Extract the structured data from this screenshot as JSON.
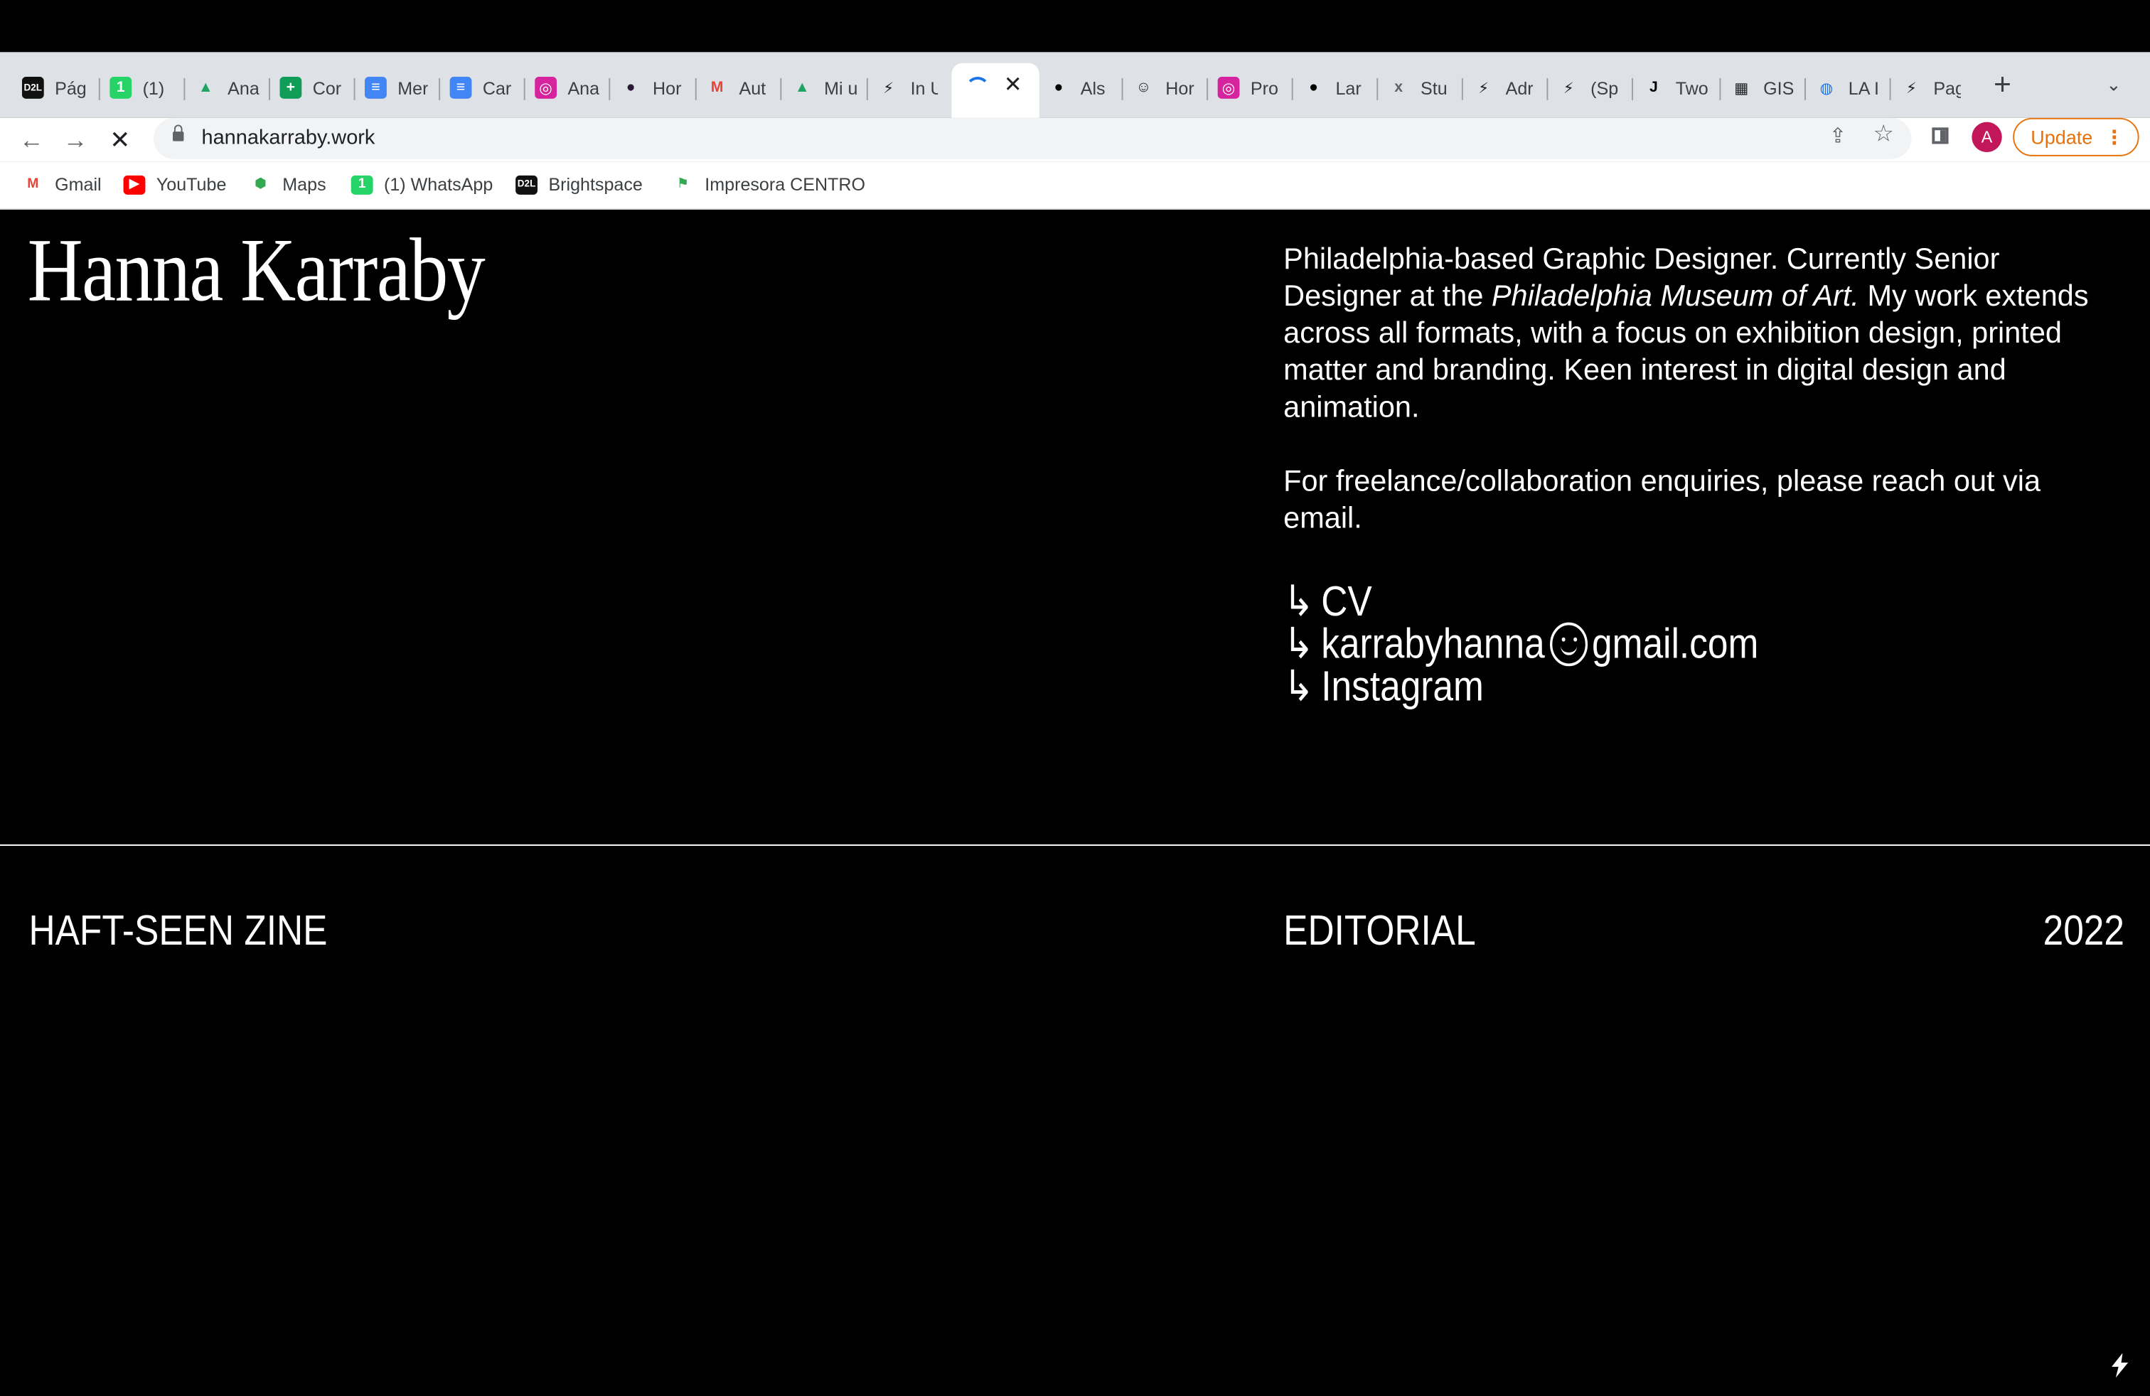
{
  "browser": {
    "tabs": [
      {
        "title": "Pág",
        "icon": "d2l-icon",
        "icon_glyph": "D2L",
        "icon_bg": "#111111",
        "icon_fg": "#ffffff"
      },
      {
        "title": "(1)",
        "icon": "whatsapp-icon",
        "icon_glyph": "1",
        "icon_bg": "#25d366",
        "icon_fg": "#ffffff"
      },
      {
        "title": "Ana",
        "icon": "google-drive-icon",
        "icon_glyph": "▲",
        "icon_bg": "transparent",
        "icon_fg": "#1fa463"
      },
      {
        "title": "Cor",
        "icon": "google-sheets-icon",
        "icon_glyph": "+",
        "icon_bg": "#0f9d58",
        "icon_fg": "#ffffff"
      },
      {
        "title": "Mer",
        "icon": "google-docs-icon",
        "icon_glyph": "≡",
        "icon_bg": "#4285f4",
        "icon_fg": "#ffffff"
      },
      {
        "title": "Car",
        "icon": "google-docs-icon",
        "icon_glyph": "≡",
        "icon_bg": "#4285f4",
        "icon_fg": "#ffffff"
      },
      {
        "title": "Ana",
        "icon": "instagram-icon",
        "icon_glyph": "◎",
        "icon_bg": "#d6249f",
        "icon_fg": "#ffffff"
      },
      {
        "title": "Hor",
        "icon": "dark-circle-icon",
        "icon_glyph": "●",
        "icon_bg": "transparent",
        "icon_fg": "#2b1836"
      },
      {
        "title": "Aut",
        "icon": "gmail-icon",
        "icon_glyph": "M",
        "icon_bg": "transparent",
        "icon_fg": "#ea4335"
      },
      {
        "title": "Mi u",
        "icon": "google-drive-icon",
        "icon_glyph": "▲",
        "icon_bg": "transparent",
        "icon_fg": "#1fa463"
      },
      {
        "title": "In U",
        "icon": "bolt-icon",
        "icon_glyph": "⚡",
        "icon_bg": "transparent",
        "icon_fg": "#202124"
      },
      {
        "title": "Als",
        "icon": "black-circle-icon",
        "icon_glyph": "●",
        "icon_bg": "transparent",
        "icon_fg": "#000000"
      },
      {
        "title": "Hor",
        "icon": "smiley-icon",
        "icon_glyph": "☺",
        "icon_bg": "transparent",
        "icon_fg": "#202124"
      },
      {
        "title": "Pro",
        "icon": "instagram-icon",
        "icon_glyph": "◎",
        "icon_bg": "#d6249f",
        "icon_fg": "#ffffff"
      },
      {
        "title": "Lar",
        "icon": "black-circle-icon",
        "icon_glyph": "●",
        "icon_bg": "transparent",
        "icon_fg": "#000000"
      },
      {
        "title": "Stu",
        "icon": "x-mark-icon",
        "icon_glyph": "x",
        "icon_bg": "transparent",
        "icon_fg": "#5f6368"
      },
      {
        "title": "Adr",
        "icon": "bolt-icon",
        "icon_glyph": "⚡",
        "icon_bg": "transparent",
        "icon_fg": "#202124"
      },
      {
        "title": "(Sp",
        "icon": "bolt-icon",
        "icon_glyph": "⚡",
        "icon_bg": "transparent",
        "icon_fg": "#202124"
      },
      {
        "title": "Two",
        "icon": "j-letter-icon",
        "icon_glyph": "J",
        "icon_bg": "transparent",
        "icon_fg": "#000000"
      },
      {
        "title": "GIS",
        "icon": "gis-map-icon",
        "icon_glyph": "▦",
        "icon_bg": "transparent",
        "icon_fg": "#202124"
      },
      {
        "title": "LA I",
        "icon": "globe-icon",
        "icon_glyph": "◍",
        "icon_bg": "transparent",
        "icon_fg": "#1a73e8"
      },
      {
        "title": "Pag",
        "icon": "bolt-icon",
        "icon_glyph": "⚡",
        "icon_bg": "transparent",
        "icon_fg": "#202124"
      }
    ],
    "active_tab": {
      "close_glyph": "✕"
    },
    "new_tab_glyph": "+",
    "tab_search_glyph": "⌄",
    "nav": {
      "back_glyph": "←",
      "forward_glyph": "→",
      "stop_glyph": "✕"
    },
    "url": "hannakarraby.work",
    "share_glyph": "⇪",
    "bookmark_glyph": "☆",
    "profile_initial": "A",
    "update_label": "Update",
    "update_menu_glyph": "⋮",
    "bookmarks": [
      {
        "label": "Gmail",
        "icon": "gmail-icon",
        "icon_glyph": "M",
        "icon_bg": "transparent",
        "icon_fg": "#ea4335"
      },
      {
        "label": "YouTube",
        "icon": "youtube-icon",
        "icon_glyph": "▶",
        "icon_bg": "#ff0000",
        "icon_fg": "#ffffff"
      },
      {
        "label": "Maps",
        "icon": "google-maps-icon",
        "icon_glyph": "⬢",
        "icon_bg": "transparent",
        "icon_fg": "#34a853"
      },
      {
        "label": "(1) WhatsApp",
        "icon": "whatsapp-icon",
        "icon_glyph": "1",
        "icon_bg": "#25d366",
        "icon_fg": "#ffffff"
      },
      {
        "label": "Brightspace",
        "icon": "d2l-icon",
        "icon_glyph": "D2L",
        "icon_bg": "#111111",
        "icon_fg": "#ffffff"
      },
      {
        "label": "Impresora CENTRO",
        "icon": "chat-flag-icon",
        "icon_glyph": "⚑",
        "icon_bg": "transparent",
        "icon_fg": "#34a853"
      }
    ]
  },
  "site": {
    "name": "Hanna Karraby",
    "bio": {
      "p1_part1": "Philadelphia-based Graphic Designer. Currently Senior Designer at the ",
      "p1_em": "Philadelphia Museum of Art.",
      "p1_part2": " My work extends across all formats, with a focus on exhibition design, printed matter and branding. Keen interest in digital design and animation.",
      "p2": "For freelance/collaboration enquiries, please reach out via email."
    },
    "links": {
      "arrow": "↳",
      "cv": "CV",
      "email_user": "karrabyhanna",
      "email_domain": "gmail.com",
      "instagram": "Instagram"
    },
    "project": {
      "title": "HAFT-SEEN ZINE",
      "category": "EDITORIAL",
      "year": "2022"
    }
  }
}
